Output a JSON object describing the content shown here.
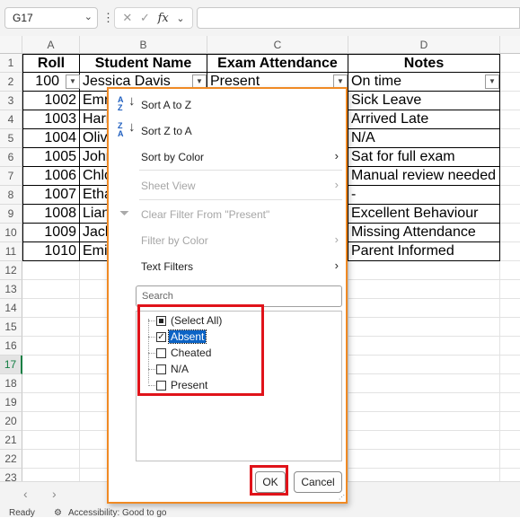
{
  "formula_bar": {
    "name_box": "G17",
    "cancel_icon": "✕",
    "enter_icon": "✓",
    "fx_label": "fx",
    "formula": ""
  },
  "columns": [
    "A",
    "B",
    "C",
    "D"
  ],
  "rows": [
    "1",
    "2",
    "3",
    "4",
    "5",
    "6",
    "7",
    "8",
    "9",
    "10",
    "11",
    "12",
    "13",
    "14",
    "15",
    "16",
    "17",
    "18",
    "19",
    "20",
    "21",
    "22",
    "23"
  ],
  "active_row": "17",
  "table": {
    "headers": [
      "Roll",
      "Student Name",
      "Exam Attendance",
      "Notes"
    ],
    "data": [
      [
        "100",
        "Jessica Davis",
        "Present",
        "On time"
      ],
      [
        "1002",
        "Emr",
        "",
        "Sick Leave"
      ],
      [
        "1003",
        "Harr",
        "",
        "Arrived Late"
      ],
      [
        "1004",
        "Oliv",
        "",
        "N/A"
      ],
      [
        "1005",
        "John",
        "",
        "Sat for full exam"
      ],
      [
        "1006",
        "Chlo",
        "",
        "Manual review needed"
      ],
      [
        "1007",
        "Etha",
        "",
        "-"
      ],
      [
        "1008",
        "Lian",
        "",
        "Excellent Behaviour"
      ],
      [
        "1009",
        "Jack",
        "",
        "Missing Attendance"
      ],
      [
        "1010",
        "Emi",
        "",
        "Parent Informed"
      ]
    ]
  },
  "filter_menu": {
    "sort_az": "Sort A to Z",
    "sort_za": "Sort Z to A",
    "sort_by_color": "Sort by Color",
    "sheet_view": "Sheet View",
    "clear_filter": "Clear Filter From \"Present\"",
    "filter_by_color": "Filter by Color",
    "text_filters": "Text Filters",
    "search_placeholder": "Search",
    "items": [
      {
        "label": "(Select All)",
        "state": "partial"
      },
      {
        "label": "Absent",
        "state": "checked"
      },
      {
        "label": "Cheated",
        "state": "unchecked"
      },
      {
        "label": "N/A",
        "state": "unchecked"
      },
      {
        "label": "Present",
        "state": "unchecked"
      }
    ],
    "ok": "OK",
    "cancel": "Cancel"
  },
  "status": {
    "ready": "Ready",
    "accessibility": "Accessibility: Good to go"
  },
  "colors": {
    "accent": "#137e43",
    "popup_border": "#f08a24",
    "highlight_red": "#e0131a",
    "selection_blue": "#0b63c5"
  }
}
